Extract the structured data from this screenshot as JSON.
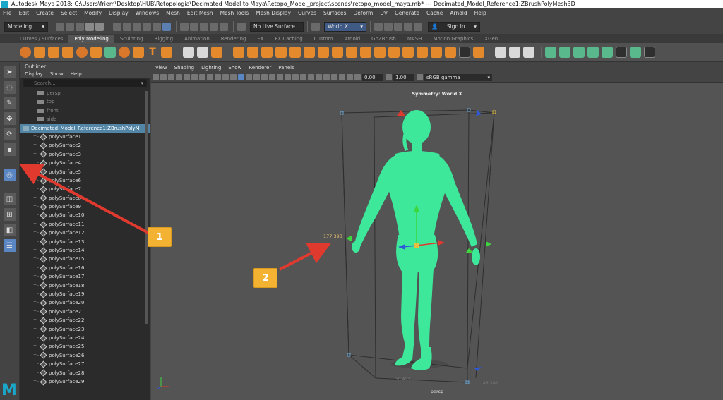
{
  "window": {
    "title": "Autodesk Maya 2018: C:\\Users\\friem\\Desktop\\HUB\\Retopologia\\Decimated Model to Maya\\Retopo_Model_project\\scenes\\retopo_model_maya.mb* --- Decimated_Model_Reference1:ZBrushPolyMesh3D"
  },
  "menubar": [
    "File",
    "Edit",
    "Create",
    "Select",
    "Modify",
    "Display",
    "Windows",
    "Mesh",
    "Edit Mesh",
    "Mesh Tools",
    "Mesh Display",
    "Curves",
    "Surfaces",
    "Deform",
    "UV",
    "Generate",
    "Cache",
    "Arnold",
    "Help"
  ],
  "statusline": {
    "mode": "Modeling",
    "live_surface": "No Live Surface",
    "symmetry": "World X",
    "sign_in": "Sign In"
  },
  "shelf_tabs": [
    "Curves / Surfaces",
    "Poly Modeling",
    "Sculpting",
    "Rigging",
    "Animation",
    "Rendering",
    "FX",
    "FX Caching",
    "Custom",
    "Arnold",
    "GoZBrush",
    "MASH",
    "Motion Graphics",
    "XGen"
  ],
  "shelf_active": "Poly Modeling",
  "outliner": {
    "title": "Outliner",
    "menu": [
      "Display",
      "Show",
      "Help"
    ],
    "search_placeholder": "Search...",
    "cameras": [
      "persp",
      "top",
      "front",
      "side"
    ],
    "reference": "Decimated_Model_Reference1:ZBrushPolyM",
    "surfaces": [
      "polySurface1",
      "polySurface2",
      "polySurface3",
      "polySurface4",
      "polySurface5",
      "polySurface6",
      "polySurface7",
      "polySurface8",
      "polySurface9",
      "polySurface10",
      "polySurface11",
      "polySurface12",
      "polySurface13",
      "polySurface14",
      "polySurface15",
      "polySurface16",
      "polySurface17",
      "polySurface18",
      "polySurface19",
      "polySurface20",
      "polySurface21",
      "polySurface22",
      "polySurface23",
      "polySurface24",
      "polySurface25",
      "polySurface26",
      "polySurface27",
      "polySurface28",
      "polySurface29"
    ]
  },
  "viewport": {
    "menu": [
      "View",
      "Shading",
      "Lighting",
      "Show",
      "Renderer",
      "Panels"
    ],
    "exposure": "0.00",
    "gamma_value": "1.00",
    "color_space": "sRGB gamma",
    "symmetry_label": "Symmetry: World X",
    "camera_label": "persp",
    "dimension_label": "177.393",
    "grid_label_left": "50.493",
    "grid_label_right": "48.386",
    "model_color": "#3ee89b"
  },
  "callouts": [
    "1",
    "2"
  ],
  "accent_colors": {
    "arrow": "#e03a2f",
    "callout": "#f4b233",
    "selection": "#5285a6"
  }
}
